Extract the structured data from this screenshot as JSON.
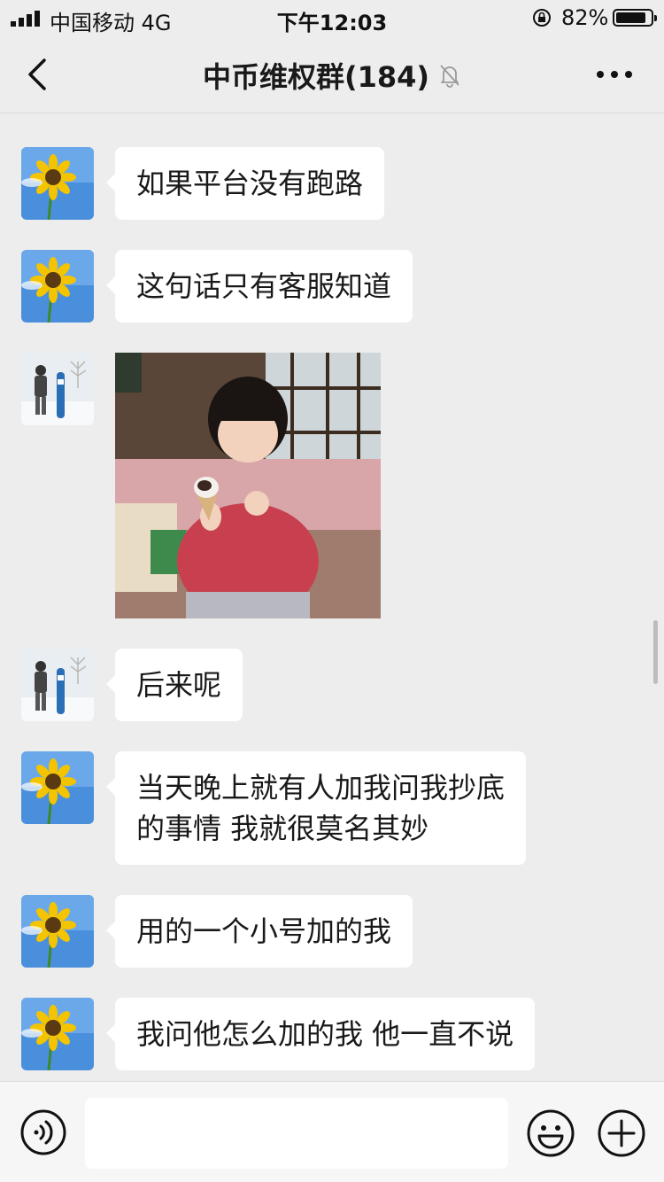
{
  "status_bar": {
    "carrier": "中国移动  4G",
    "time": "下午12:03",
    "battery": "82%"
  },
  "nav": {
    "title": "中币维权群(184)",
    "back_icon": "chevron-left-icon",
    "mute_icon": "bell-off-icon",
    "more_icon": "more-dots-icon"
  },
  "messages": [
    {
      "sender_avatar": "sunflower",
      "type": "text",
      "text": "如果平台没有跑路"
    },
    {
      "sender_avatar": "sunflower",
      "type": "text",
      "text": "这句话只有客服知道"
    },
    {
      "sender_avatar": "snowboarder",
      "type": "image",
      "image": "child-eating-ice-cream"
    },
    {
      "sender_avatar": "snowboarder",
      "type": "text",
      "text": "后来呢"
    },
    {
      "sender_avatar": "sunflower",
      "type": "text",
      "text": "当天晚上就有人加我问我抄底\n的事情 我就很莫名其妙"
    },
    {
      "sender_avatar": "sunflower",
      "type": "text",
      "text": "用的一个小号加的我"
    },
    {
      "sender_avatar": "sunflower",
      "type": "text",
      "text": "我问他怎么加的我 他一直不说"
    }
  ],
  "input_bar": {
    "placeholder": "",
    "voice_icon": "voice-icon",
    "emoji_icon": "emoji-icon",
    "plus_icon": "plus-icon"
  },
  "colors": {
    "background": "#ededed",
    "bubble": "#ffffff",
    "sunflower_sky": "#4a90e2"
  }
}
